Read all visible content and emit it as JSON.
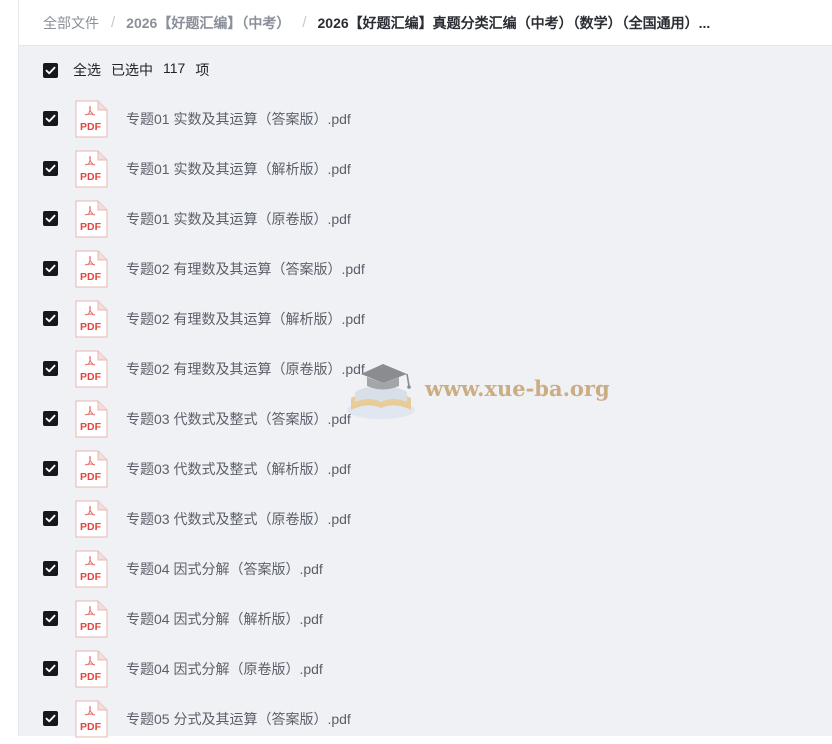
{
  "breadcrumb": {
    "items": [
      "全部文件",
      "2026【好题汇编】（中考）",
      "2026【好题汇编】真题分类汇编（中考）（数学）（全国通用）..."
    ]
  },
  "selection": {
    "select_all_label": "全选",
    "selected_prefix": "已选中",
    "selected_count": "117",
    "selected_suffix": "项",
    "all_checked": true
  },
  "file_icon_label": "PDF",
  "files": [
    {
      "name": "专题01 实数及其运算（答案版）.pdf",
      "checked": true
    },
    {
      "name": "专题01 实数及其运算（解析版）.pdf",
      "checked": true
    },
    {
      "name": "专题01 实数及其运算（原卷版）.pdf",
      "checked": true
    },
    {
      "name": "专题02 有理数及其运算（答案版）.pdf",
      "checked": true
    },
    {
      "name": "专题02 有理数及其运算（解析版）.pdf",
      "checked": true
    },
    {
      "name": "专题02 有理数及其运算（原卷版）.pdf",
      "checked": true
    },
    {
      "name": "专题03 代数式及整式（答案版）.pdf",
      "checked": true
    },
    {
      "name": "专题03 代数式及整式（解析版）.pdf",
      "checked": true
    },
    {
      "name": "专题03 代数式及整式（原卷版）.pdf",
      "checked": true
    },
    {
      "name": "专题04 因式分解（答案版）.pdf",
      "checked": true
    },
    {
      "name": "专题04 因式分解（解析版）.pdf",
      "checked": true
    },
    {
      "name": "专题04 因式分解（原卷版）.pdf",
      "checked": true
    },
    {
      "name": "专题05 分式及其运算（答案版）.pdf",
      "checked": true
    }
  ],
  "watermark": {
    "text": "www.xue-ba.org"
  },
  "colors": {
    "pdf_red": "#e0463f",
    "checkbox": "#15181d",
    "background": "#f0f1f4"
  }
}
